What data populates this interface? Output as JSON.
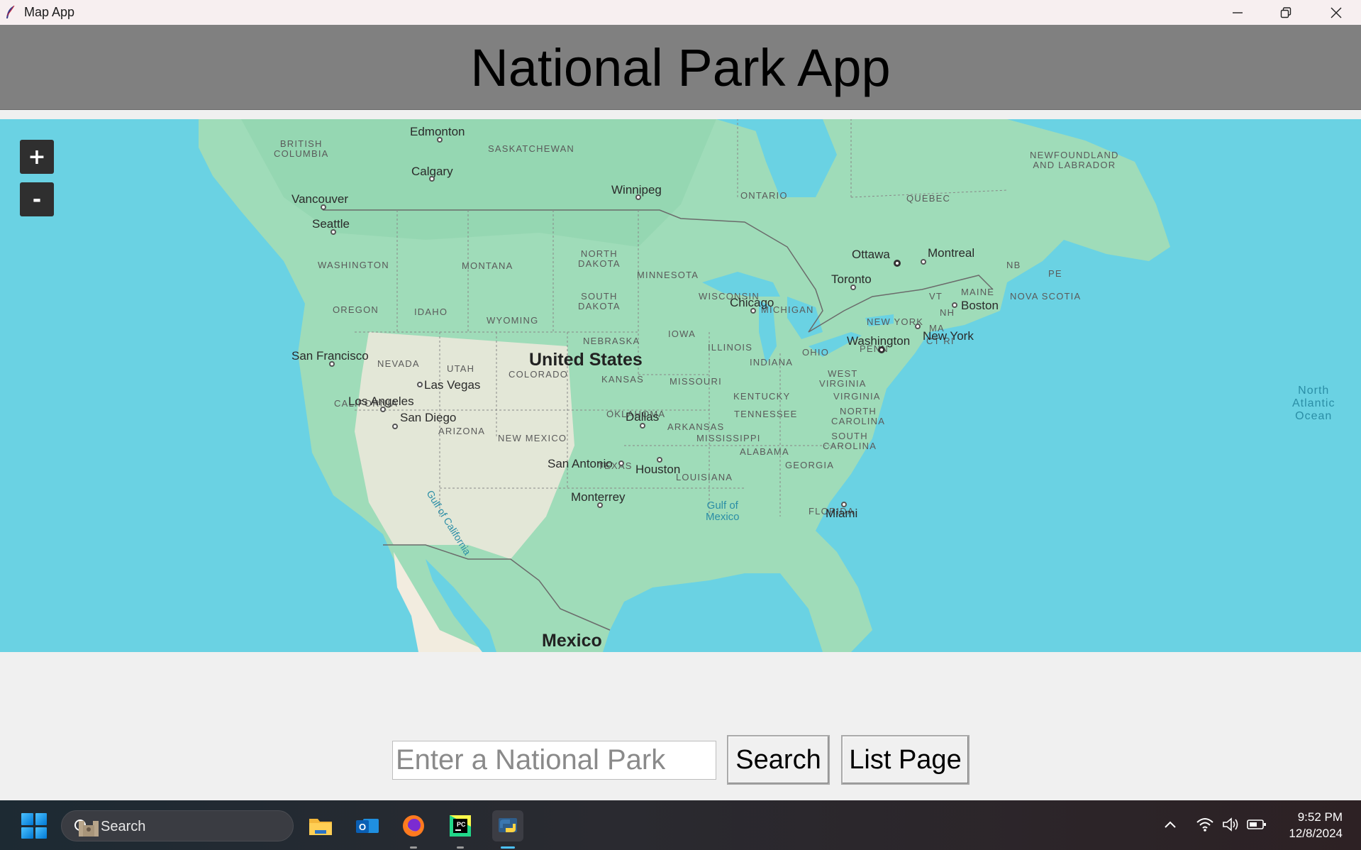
{
  "window": {
    "title": "Map App",
    "app_icon": "feather-icon",
    "controls": [
      "minimize-icon",
      "restore-icon",
      "close-icon"
    ]
  },
  "header": {
    "title": "National Park App",
    "background": "#808080"
  },
  "map": {
    "zoom_in_label": "+",
    "zoom_out_label": "-",
    "water_color": "#6ad2e3",
    "land_color": "#9fdcb9",
    "country_labels": {
      "us": "United States",
      "mexico": "Mexico"
    },
    "region_labels": {
      "british_columbia": "BRITISH\nCOLUMBIA",
      "saskatchewan": "SASKATCHEWAN",
      "ontario": "ONTARIO",
      "quebec": "QUEBEC",
      "newfoundland": "NEWFOUNDLAND\nAND LABRADOR",
      "washington": "WASHINGTON",
      "montana": "MONTANA",
      "north_dakota": "NORTH\nDAKOTA",
      "minnesota": "MINNESOTA",
      "nb": "NB",
      "pe": "PE",
      "maine": "MAINE",
      "nova_scotia": "NOVA SCOTIA",
      "oregon": "OREGON",
      "idaho": "IDAHO",
      "south_dakota": "SOUTH\nDAKOTA",
      "wisconsin": "WISCONSIN",
      "michigan": "MICHIGAN",
      "vt": "VT",
      "nh": "NH",
      "wyoming": "WYOMING",
      "new_york": "NEW YORK",
      "ma": "MA",
      "ct_ri": "CT RI",
      "nebraska": "NEBRASKA",
      "iowa": "IOWA",
      "illinois": "ILLINOIS",
      "nevada": "NEVADA",
      "utah": "UTAH",
      "ohio": "OHIO",
      "penn": "PENN",
      "indiana": "INDIANA",
      "colorado": "COLORADO",
      "kansas": "KANSAS",
      "west_virginia": "WEST\nVIRGINIA",
      "missouri": "MISSOURI",
      "kentucky": "KENTUCKY",
      "virginia": "VIRGINIA",
      "california": "CALIFORNIA",
      "oklahoma": "OKLAHOMA",
      "tennessee": "TENNESSEE",
      "north_carolina": "NORTH\nCAROLINA",
      "arizona": "ARIZONA",
      "arkansas": "ARKANSAS",
      "new_mexico": "NEW MEXICO",
      "mississippi": "MISSISSIPPI",
      "south_carolina": "SOUTH\nCAROLINA",
      "alabama": "ALABAMA",
      "georgia": "GEORGIA",
      "texas": "TEXAS",
      "louisiana": "LOUISIANA",
      "florida": "FLORIDA"
    },
    "city_labels": {
      "edmonton": "Edmonton",
      "calgary": "Calgary",
      "winnipeg": "Winnipeg",
      "vancouver": "Vancouver",
      "seattle": "Seattle",
      "ottawa": "Ottawa",
      "montreal": "Montreal",
      "toronto": "Toronto",
      "boston": "Boston",
      "chicago": "Chicago",
      "washington": "Washington",
      "new_york": "New York",
      "san_francisco": "San Francisco",
      "las_vegas": "Las Vegas",
      "los_angeles": "Los Angeles",
      "san_diego": "San Diego",
      "dallas": "Dallas",
      "san_antonio": "San Antonio",
      "houston": "Houston",
      "monterrey": "Monterrey",
      "miami": "Miami"
    },
    "water_labels": {
      "north_atlantic": "North\nAtlantic\nOcean",
      "gulf_of_mexico": "Gulf of\nMexico",
      "gulf_of_california": "Gulf of California"
    }
  },
  "search": {
    "placeholder": "Enter a National Park",
    "value": "",
    "search_button": "Search",
    "list_button": "List Page"
  },
  "taskbar": {
    "search_label": "Search",
    "apps": [
      "file-explorer-icon",
      "outlook-icon",
      "firefox-icon",
      "pycharm-icon",
      "python-icon"
    ],
    "time": "9:52 PM",
    "date": "12/8/2024"
  }
}
